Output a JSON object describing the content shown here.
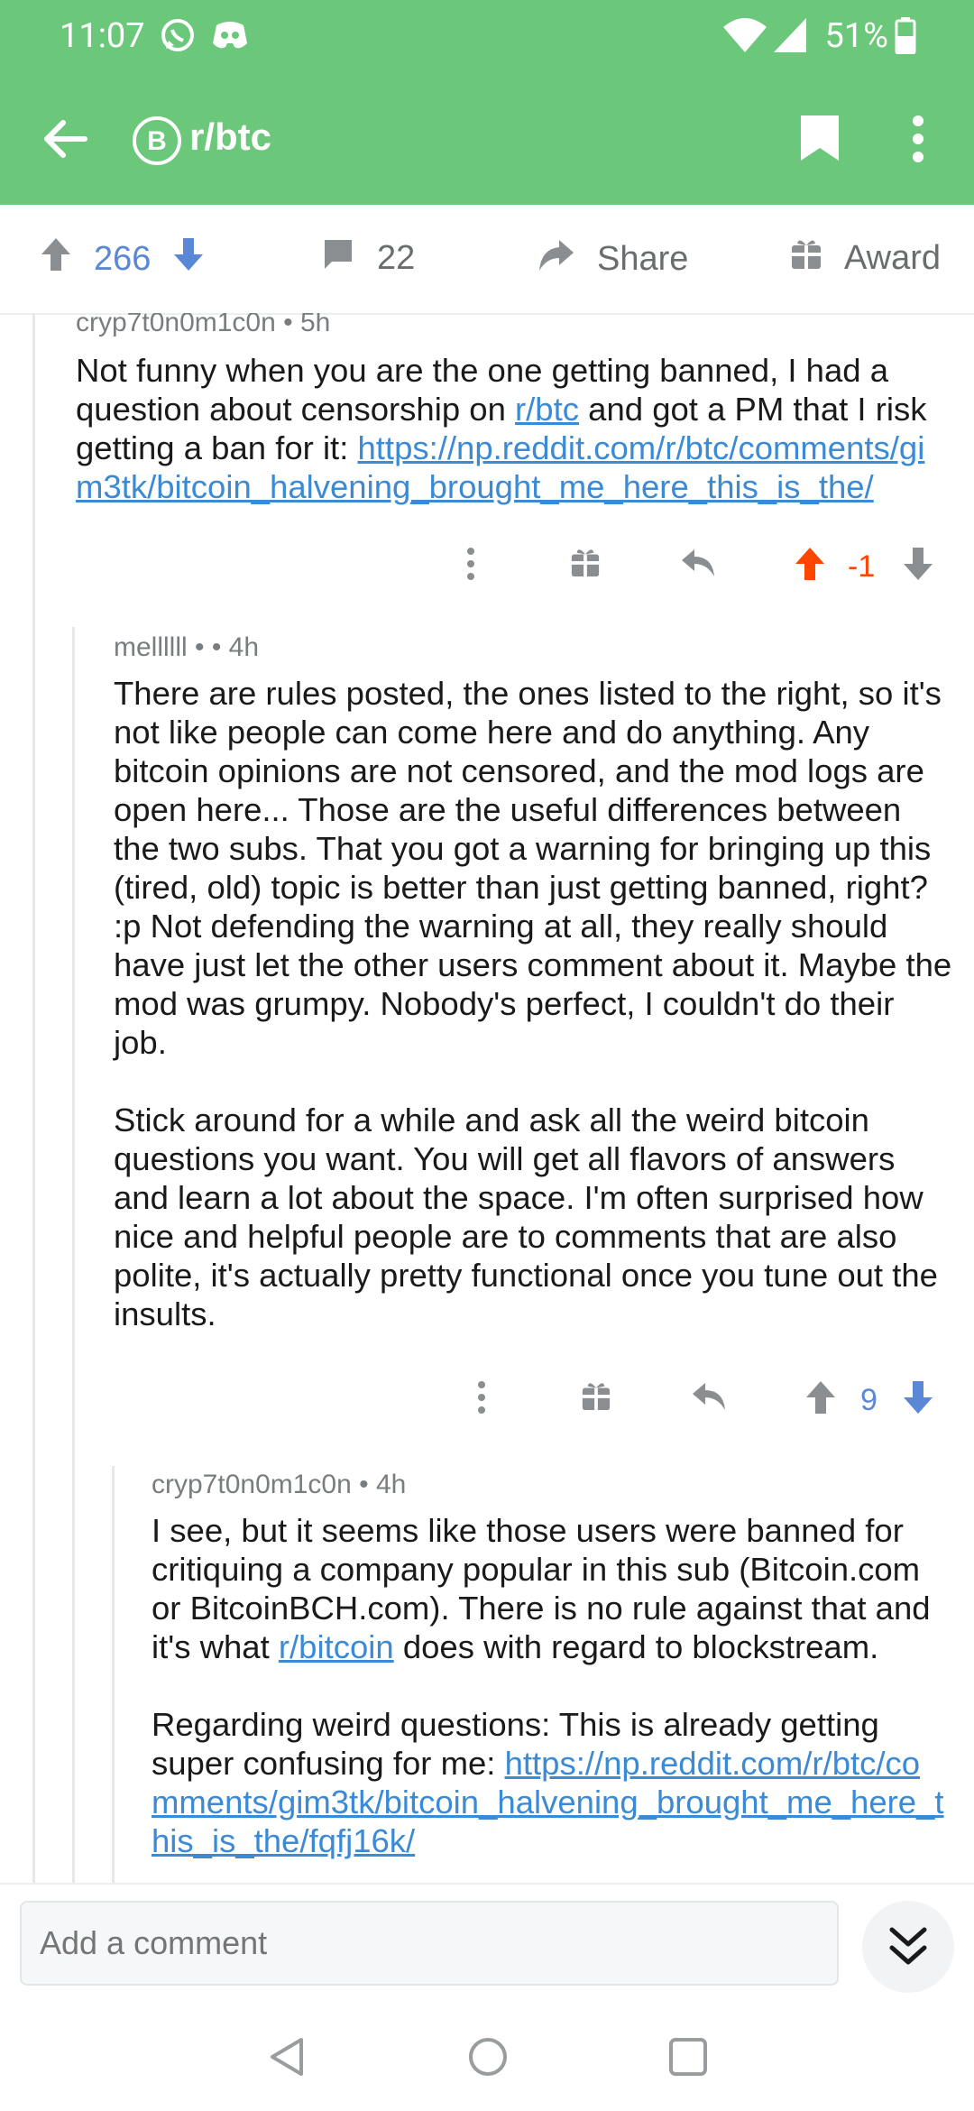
{
  "status": {
    "time": "11:07",
    "battery": "51%"
  },
  "header": {
    "title": "r/btc"
  },
  "post_actions": {
    "upvotes": "266",
    "comments": "22",
    "share": "Share",
    "award": "Award"
  },
  "comments": [
    {
      "author": "cryp7t0n0m1c0n • 5h",
      "text_parts": [
        "Not funny when you are the one getting banned, I had a question about censorship on ",
        "r/btc",
        " and got a PM that I risk getting a ban for it: ",
        "https://np.reddit.com/r/btc/comments/gim3tk/bitcoin_halvening_brought_me_here_this_is_the/"
      ],
      "score": "-1"
    },
    {
      "author": "mellllll •  • 4h",
      "para1": "There are rules posted, the ones listed to the right, so it's not like people can come here and do anything. Any bitcoin opinions are not censored, and the mod logs are open here... Those are the useful differences between the two subs. That you got a warning for bringing up this (tired, old) topic is better than just getting banned, right? :p Not defending the warning at all, they really should have just let the other users comment about it. Maybe the mod was grumpy. Nobody's perfect, I couldn't do their job.",
      "para2": "Stick around for a while and ask all the weird bitcoin questions you want. You will get all flavors of answers and learn a lot about the space. I'm often surprised how nice and helpful people are to comments that are also polite, it's actually pretty functional once you tune out the insults.",
      "score": "9"
    },
    {
      "author": "cryp7t0n0m1c0n • 4h",
      "para1_parts": [
        "I see, but it seems like those users were banned for critiquing a company popular in this sub (Bitcoin.com or BitcoinBCH.com). There is no rule against that and it's what ",
        "r/bitcoin",
        " does with regard to blockstream."
      ],
      "para2_parts": [
        "Regarding weird questions: This is already getting super confusing for me: ",
        "https://np.reddit.com/r/btc/comments/gim3tk/bitcoin_halvening_brought_me_here_this_is_the/fqfj16k/"
      ]
    }
  ],
  "composer": {
    "placeholder": "Add a comment"
  },
  "colors": {
    "header_green": "#6bc77a",
    "upvote_orange": "#ff4500",
    "downvote_blue": "#5a87d6",
    "link_blue": "#3a8ad6"
  }
}
